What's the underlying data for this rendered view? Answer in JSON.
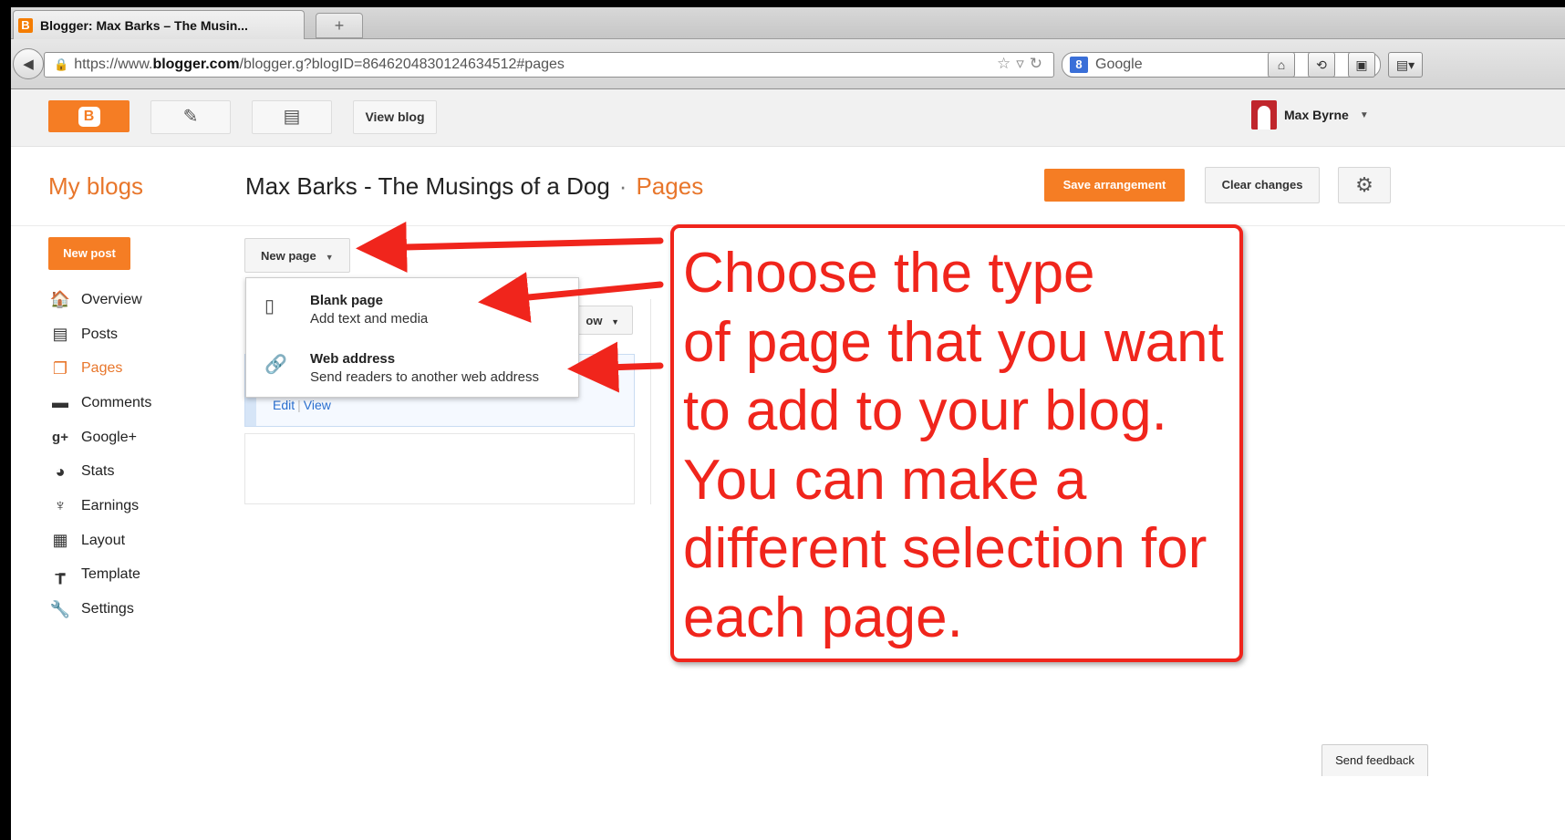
{
  "browser": {
    "tab_title": "Blogger: Max Barks – The Musin...",
    "new_tab": "+",
    "url_prefix": "https://www.",
    "url_domain": "blogger.com",
    "url_path": "/blogger.g?blogID=8646204830124634512#pages",
    "search_engine": "Google",
    "search_engine_icon": "8"
  },
  "header": {
    "logo_letter": "B",
    "view_blog": "View blog",
    "user_name": "Max Byrne"
  },
  "titlebar": {
    "my_blogs": "My blogs",
    "blog_title": "Max Barks - The Musings of a Dog",
    "separator": "·",
    "section": "Pages",
    "save_arrangement": "Save arrangement",
    "clear_changes": "Clear changes"
  },
  "sidebar": {
    "new_post": "New post",
    "items": [
      {
        "label": "Overview",
        "icon": "home-icon",
        "glyph": "🏠"
      },
      {
        "label": "Posts",
        "icon": "posts-icon",
        "glyph": "▤"
      },
      {
        "label": "Pages",
        "icon": "pages-icon",
        "glyph": "❐"
      },
      {
        "label": "Comments",
        "icon": "comments-icon",
        "glyph": "▬"
      },
      {
        "label": "Google+",
        "icon": "googleplus-icon",
        "glyph": "g+"
      },
      {
        "label": "Stats",
        "icon": "stats-icon",
        "glyph": "◕"
      },
      {
        "label": "Earnings",
        "icon": "trophy-icon",
        "glyph": "♆"
      },
      {
        "label": "Layout",
        "icon": "layout-icon",
        "glyph": "▦"
      },
      {
        "label": "Template",
        "icon": "paint-roller-icon",
        "glyph": "┲"
      },
      {
        "label": "Settings",
        "icon": "wrench-icon",
        "glyph": "🔧"
      }
    ]
  },
  "main": {
    "new_page": "New page",
    "show_partial": "ow",
    "dropdown": [
      {
        "title": "Blank page",
        "subtitle": "Add text and media",
        "icon": "blank-page-icon"
      },
      {
        "title": "Web address",
        "subtitle": "Send readers to another web address",
        "icon": "link-icon"
      }
    ],
    "card_edit": "Edit",
    "card_sep": "|",
    "card_view": "View"
  },
  "callout": {
    "lines": [
      "Choose the type",
      "of page that you want",
      "to add to your blog.",
      "You can make a",
      "different selection for",
      "each page."
    ],
    "color": "#f0251c"
  },
  "footer": {
    "send_feedback": "Send feedback"
  },
  "colors": {
    "blogger_orange": "#f57d24",
    "accent_text": "#e8762b",
    "link_blue": "#2a6fcf"
  }
}
